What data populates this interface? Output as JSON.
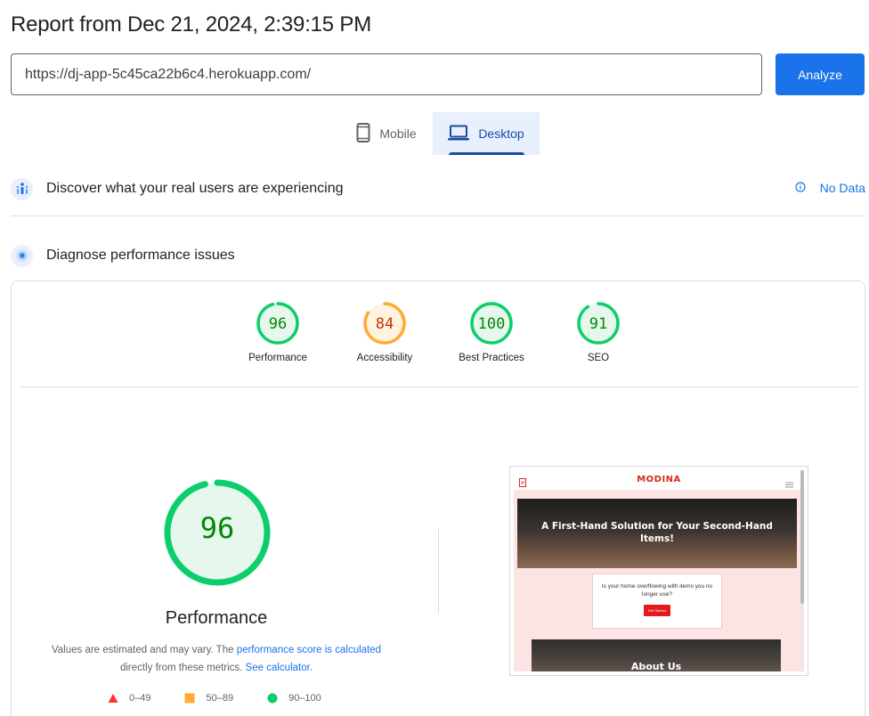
{
  "header": {
    "title": "Report from Dec 21, 2024, 2:39:15 PM"
  },
  "url_bar": {
    "value": "https://dj-app-5c45ca22b6c4.herokuapp.com/",
    "analyze_label": "Analyze"
  },
  "device_tabs": {
    "mobile_label": "Mobile",
    "desktop_label": "Desktop",
    "selected": "Desktop"
  },
  "real_users": {
    "title": "Discover what your real users are experiencing",
    "status": "No Data"
  },
  "diagnose": {
    "title": "Diagnose performance issues"
  },
  "categories": [
    {
      "label": "Performance",
      "score": "96",
      "rating": "pass"
    },
    {
      "label": "Accessibility",
      "score": "84",
      "rating": "average"
    },
    {
      "label": "Best Practices",
      "score": "100",
      "rating": "pass"
    },
    {
      "label": "SEO",
      "score": "91",
      "rating": "pass"
    }
  ],
  "main_gauge": {
    "score": "96",
    "label": "Performance"
  },
  "note": {
    "text1": "Values are estimated and may vary. The ",
    "link1": "performance score is calculated",
    "text2": "directly from these metrics. ",
    "link2": "See calculator."
  },
  "legend": [
    {
      "range": "0–49",
      "shape": "triangle",
      "color": "#ff3333"
    },
    {
      "range": "50–89",
      "shape": "square",
      "color": "#ffaa33"
    },
    {
      "range": "90–100",
      "shape": "circle",
      "color": "#0cce6b"
    }
  ],
  "screenshot": {
    "logo": "MODINA",
    "hero_title": "A First-Hand Solution for Your Second-Hand Items!",
    "box_text": "Is your home overflowing with items you no longer use?",
    "button_text": "Get Started",
    "about_title": "About Us"
  },
  "colors": {
    "pass": "#0cce6b",
    "pass_text": "#008800",
    "pass_fill": "#e6f8ed",
    "average": "#ffaa33",
    "average_text": "#c33300",
    "average_fill": "#fff3e0",
    "accent": "#1a73e8"
  }
}
